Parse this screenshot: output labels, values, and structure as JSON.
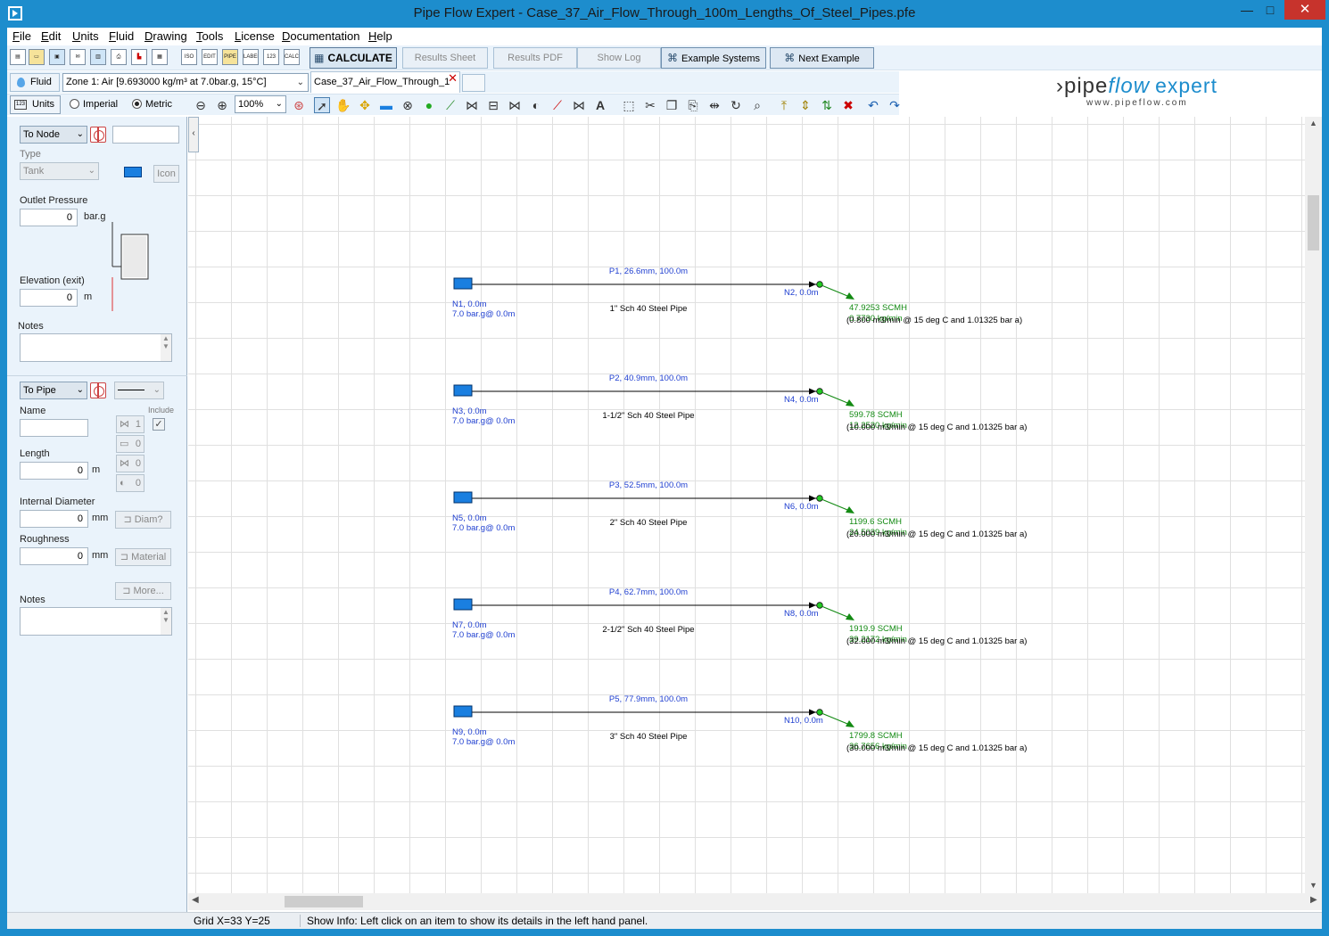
{
  "window": {
    "title": "Pipe Flow Expert - Case_37_Air_Flow_Through_100m_Lengths_Of_Steel_Pipes.pfe",
    "minimize": "—",
    "maximize": "□",
    "close": "✕"
  },
  "menu": [
    {
      "key": "F",
      "rest": "ile"
    },
    {
      "key": "E",
      "rest": "dit"
    },
    {
      "key": "U",
      "rest": "nits"
    },
    {
      "key": "F",
      "rest": "luid"
    },
    {
      "key": "D",
      "rest": "rawing"
    },
    {
      "key": "T",
      "rest": "ools"
    },
    {
      "key": "L",
      "rest": "icense"
    },
    {
      "key": "D",
      "rest": "ocumentation"
    },
    {
      "key": "H",
      "rest": "elp"
    }
  ],
  "toolbar": {
    "icon_labels": [
      "ISO",
      "EDIT",
      "PIPE",
      "LABEL",
      "123",
      "CALC"
    ],
    "calculate": "CALCULATE",
    "results_sheet": "Results Sheet",
    "results_pdf": "Results PDF",
    "show_log": "Show Log",
    "example_systems": "Example Systems",
    "next_example": "Next Example"
  },
  "fluid": {
    "button": "Fluid",
    "zone": "Zone 1: Air [9.693000 kg/m³ at 7.0bar.g, 15°C]"
  },
  "doc_tab": {
    "label": "Case_37_Air_Flow_Through_1",
    "close": "✕"
  },
  "units": {
    "button": "Units",
    "imperial": "Imperial",
    "metric": "Metric",
    "selected": "metric",
    "zoom": "100%"
  },
  "logo": {
    "pipe": "pipe",
    "flow": "flow",
    "expert": "expert",
    "url": "www.pipeflow.com"
  },
  "node_panel": {
    "selector": "To Node",
    "type_label": "Type",
    "type_value": "Tank",
    "icon_button": "Icon",
    "outlet_pressure_label": "Outlet Pressure",
    "outlet_pressure_value": "0",
    "outlet_pressure_unit": "bar.g",
    "elevation_label": "Elevation (exit)",
    "elevation_value": "0",
    "elevation_unit": "m",
    "notes_label": "Notes"
  },
  "pipe_panel": {
    "selector": "To Pipe",
    "name_label": "Name",
    "include_label": "Include",
    "fitting_counts": [
      "1",
      "0",
      "0",
      "0"
    ],
    "length_label": "Length",
    "length_value": "0",
    "length_unit": "m",
    "diameter_label": "Internal Diameter",
    "diameter_value": "0",
    "diameter_unit": "mm",
    "diameter_button": "Diam?",
    "roughness_label": "Roughness",
    "roughness_value": "0",
    "roughness_unit": "mm",
    "material_button": "Material",
    "more_button": "More...",
    "notes_label": "Notes"
  },
  "pipes": [
    {
      "pipe_label": "P1, 26.6mm, 100.0m",
      "description": "1\" Sch 40 Steel Pipe",
      "start_node": "N1, 0.0m",
      "start_pressure": "7.0 bar.g@ 0.0m",
      "end_node": "N2, 0.0m",
      "flow": "47.9253 SCMH",
      "mass_flow": "0.7730 kg/min",
      "demand": "(0.800 m3/min @ 15 deg C and 1.01325 bar a)"
    },
    {
      "pipe_label": "P2, 40.9mm, 100.0m",
      "description": "1-1/2\" Sch 40 Steel Pipe",
      "start_node": "N3, 0.0m",
      "start_pressure": "7.0 bar.g@ 0.0m",
      "end_node": "N4, 0.0m",
      "flow": "599.78 SCMH",
      "mass_flow": "12.2520 kg/min",
      "demand": "(10.000 m3/min @ 15 deg C and 1.01325 bar a)"
    },
    {
      "pipe_label": "P3, 52.5mm, 100.0m",
      "description": "2\" Sch 40 Steel Pipe",
      "start_node": "N5, 0.0m",
      "start_pressure": "7.0 bar.g@ 0.0m",
      "end_node": "N6, 0.0m",
      "flow": "1199.6 SCMH",
      "mass_flow": "24.5039 kg/min",
      "demand": "(20.000 m3/min @ 15 deg C and 1.01325 bar a)"
    },
    {
      "pipe_label": "P4, 62.7mm, 100.0m",
      "description": "2-1/2\" Sch 40 Steel Pipe",
      "start_node": "N7, 0.0m",
      "start_pressure": "7.0 bar.g@ 0.0m",
      "end_node": "N8, 0.0m",
      "flow": "1919.9 SCMH",
      "mass_flow": "39.2172 kg/min",
      "demand": "(32.000 m3/min @ 15 deg C and 1.01325 bar a)"
    },
    {
      "pipe_label": "P5, 77.9mm, 100.0m",
      "description": "3\" Sch 40 Steel Pipe",
      "start_node": "N9, 0.0m",
      "start_pressure": "7.0 bar.g@ 0.0m",
      "end_node": "N10, 0.0m",
      "flow": "1799.8 SCMH",
      "mass_flow": "36.7656 kg/min",
      "demand": "(30.000 m3/min @ 15 deg C and 1.01325 bar a)"
    }
  ],
  "status": {
    "grid": "Grid  X=33  Y=25",
    "info": "Show Info: Left click on an item to show its details in the left hand panel."
  },
  "colors": {
    "title_bar": "#1d8dcd",
    "tank": "#1a7fe0",
    "node_label": "#1f3fd0",
    "flow_green": "#138a13",
    "node_dot": "#22cc22"
  }
}
